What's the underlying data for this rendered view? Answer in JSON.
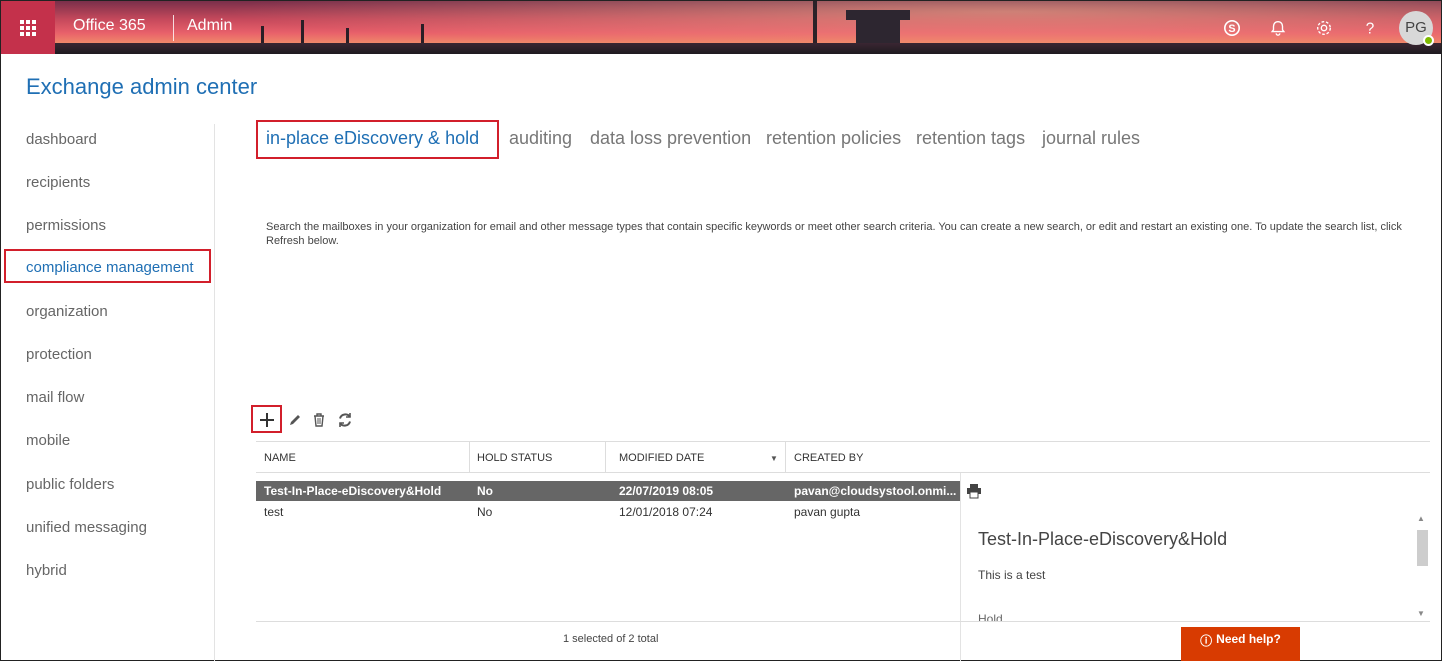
{
  "header": {
    "brand": "Office 365",
    "app": "Admin",
    "waffle_icon": "waffle-icon",
    "avatar_initials": "PG",
    "icons": [
      "skype-icon",
      "bell-icon",
      "gear-icon",
      "help-icon"
    ]
  },
  "page_title": "Exchange admin center",
  "nav": {
    "items": [
      "dashboard",
      "recipients",
      "permissions",
      "compliance management",
      "organization",
      "protection",
      "mail flow",
      "mobile",
      "public folders",
      "unified messaging",
      "hybrid"
    ],
    "active": "compliance management"
  },
  "tabs": {
    "items": [
      "in-place eDiscovery & hold",
      "auditing",
      "data loss prevention",
      "retention policies",
      "retention tags",
      "journal rules"
    ],
    "active": "in-place eDiscovery & hold"
  },
  "description": "Search the mailboxes in your organization for email and other message types that contain specific keywords or meet other search criteria. You can create a new search, or edit and restart an existing one. To update the search list, click Refresh below.",
  "toolbar": [
    "plus-icon",
    "pencil-icon",
    "trash-icon",
    "refresh-icon"
  ],
  "table": {
    "columns": [
      "NAME",
      "HOLD STATUS",
      "MODIFIED DATE",
      "CREATED BY"
    ],
    "rows": [
      {
        "name": "Test-In-Place-eDiscovery&Hold",
        "hold_status": "No",
        "modified_date": "22/07/2019 08:05",
        "created_by": "pavan@cloudsystool.onmi...",
        "selected": true
      },
      {
        "name": "test",
        "hold_status": "No",
        "modified_date": "12/01/2018 07:24",
        "created_by": "pavan gupta",
        "selected": false
      }
    ]
  },
  "details": {
    "title": "Test-In-Place-eDiscovery&Hold",
    "text": "This is a test",
    "sub": "Hold"
  },
  "status": "1 selected of 2 total",
  "need_help": "Need help?",
  "colors": {
    "accent": "#1f6fb4",
    "highlight": "#d21f2b",
    "need_help": "#d83b01",
    "selected_row": "#666666"
  }
}
